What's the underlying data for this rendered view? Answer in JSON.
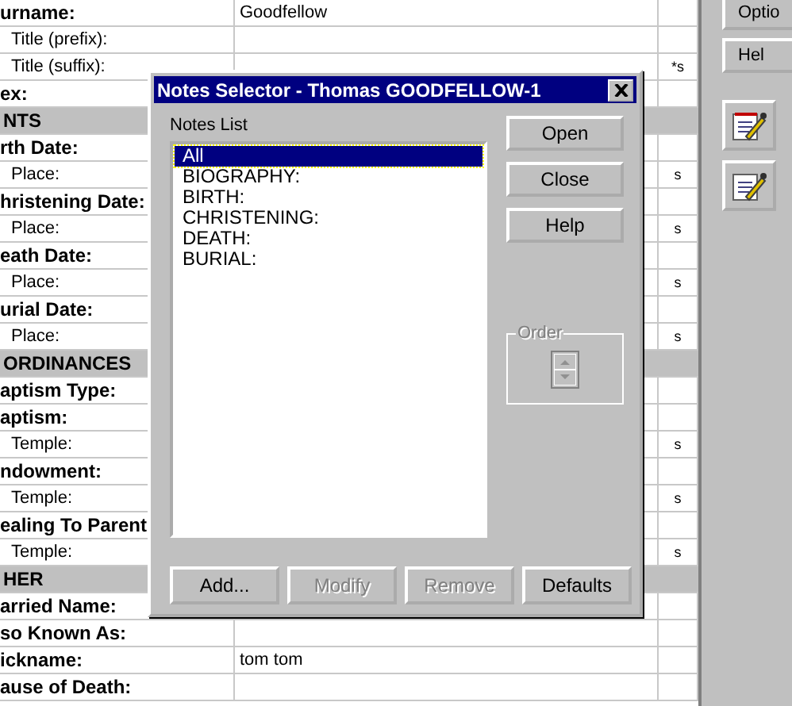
{
  "form": {
    "rows": [
      {
        "kind": "field",
        "label": "urname:",
        "value": "Goodfellow"
      },
      {
        "kind": "subfield",
        "label": "Title (prefix):"
      },
      {
        "kind": "subfield",
        "label": "Title (suffix):",
        "flag": "*s"
      },
      {
        "kind": "field",
        "label": "ex:"
      },
      {
        "kind": "section",
        "label": "NTS"
      },
      {
        "kind": "field",
        "label": "rth Date:"
      },
      {
        "kind": "subfield",
        "label": "Place:",
        "flag": "s"
      },
      {
        "kind": "field",
        "label": "hristening Date:"
      },
      {
        "kind": "subfield",
        "label": "Place:",
        "flag": "s"
      },
      {
        "kind": "field",
        "label": "eath Date:"
      },
      {
        "kind": "subfield",
        "label": "Place:",
        "flag": "s"
      },
      {
        "kind": "field",
        "label": "urial Date:"
      },
      {
        "kind": "subfield",
        "label": "Place:",
        "flag": "s"
      },
      {
        "kind": "section",
        "label": "ORDINANCES"
      },
      {
        "kind": "field",
        "label": "aptism Type:"
      },
      {
        "kind": "field",
        "label": "aptism:"
      },
      {
        "kind": "subfield",
        "label": "Temple:",
        "flag": "s"
      },
      {
        "kind": "field",
        "label": "ndowment:"
      },
      {
        "kind": "subfield",
        "label": "Temple:",
        "flag": "s"
      },
      {
        "kind": "field",
        "label": "ealing To Parent"
      },
      {
        "kind": "subfield",
        "label": "Temple:",
        "flag": "s"
      },
      {
        "kind": "section",
        "label": "HER"
      },
      {
        "kind": "field",
        "label": "arried Name:"
      },
      {
        "kind": "field",
        "label": "so Known As:"
      },
      {
        "kind": "field",
        "label": "ickname:",
        "value": "tom tom"
      },
      {
        "kind": "field",
        "label": "ause of Death:"
      }
    ]
  },
  "side_panel": {
    "buttons": [
      {
        "label": "Optio"
      },
      {
        "label": "Hel"
      }
    ]
  },
  "dialog": {
    "title": "Notes Selector - Thomas GOODFELLOW-1",
    "list_label": "Notes List",
    "notes": [
      {
        "label": "All",
        "selected": true
      },
      {
        "label": "BIOGRAPHY:",
        "selected": false
      },
      {
        "label": "BIRTH:",
        "selected": false
      },
      {
        "label": "CHRISTENING:",
        "selected": false
      },
      {
        "label": "DEATH:",
        "selected": false
      },
      {
        "label": "BURIAL:",
        "selected": false
      }
    ],
    "side_buttons": [
      {
        "label": "Open",
        "disabled": false
      },
      {
        "label": "Close",
        "disabled": false
      },
      {
        "label": "Help",
        "disabled": false
      }
    ],
    "order": {
      "label": "Order",
      "disabled": true
    },
    "bottom_buttons": [
      {
        "label": "Add...",
        "disabled": false
      },
      {
        "label": "Modify",
        "disabled": true
      },
      {
        "label": "Remove",
        "disabled": true
      },
      {
        "label": "Defaults",
        "disabled": false
      }
    ]
  }
}
